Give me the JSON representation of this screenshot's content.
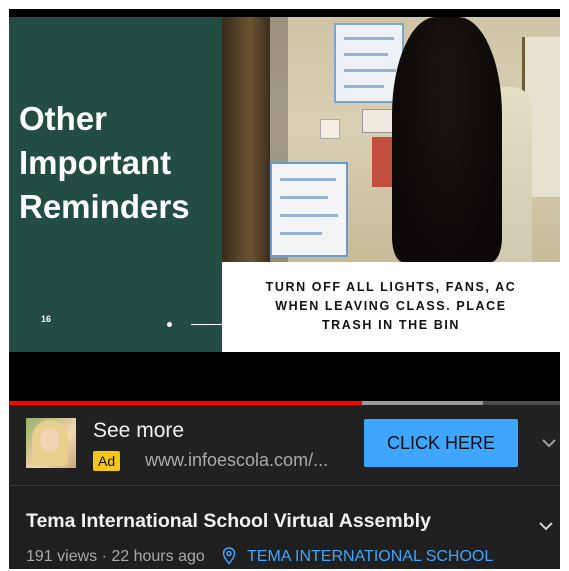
{
  "video": {
    "slide_title": "Other\nImportant\nReminders",
    "slide_number": "16",
    "caption": "TURN OFF ALL LIGHTS, FANS, AC\nWHEN LEAVING CLASS. PLACE\nTRASH IN THE BIN",
    "progress_fraction": 0.64,
    "buffer_fraction": 0.86,
    "progress_color": "#ff0000",
    "slide_bg_color": "#234d43"
  },
  "ad": {
    "title": "See more",
    "badge": "Ad",
    "url": "www.infoescola.com/...",
    "button_label": "CLICK HERE",
    "button_color": "#3ea6ff",
    "badge_color": "#f5c518"
  },
  "info": {
    "title": "Tema International School Virtual Assembly",
    "meta": "191 views · 22 hours ago",
    "channel": "TEMA INTERNATIONAL SCHOOL",
    "channel_color": "#3ea6ff",
    "location_icon": "location-pin-icon"
  }
}
